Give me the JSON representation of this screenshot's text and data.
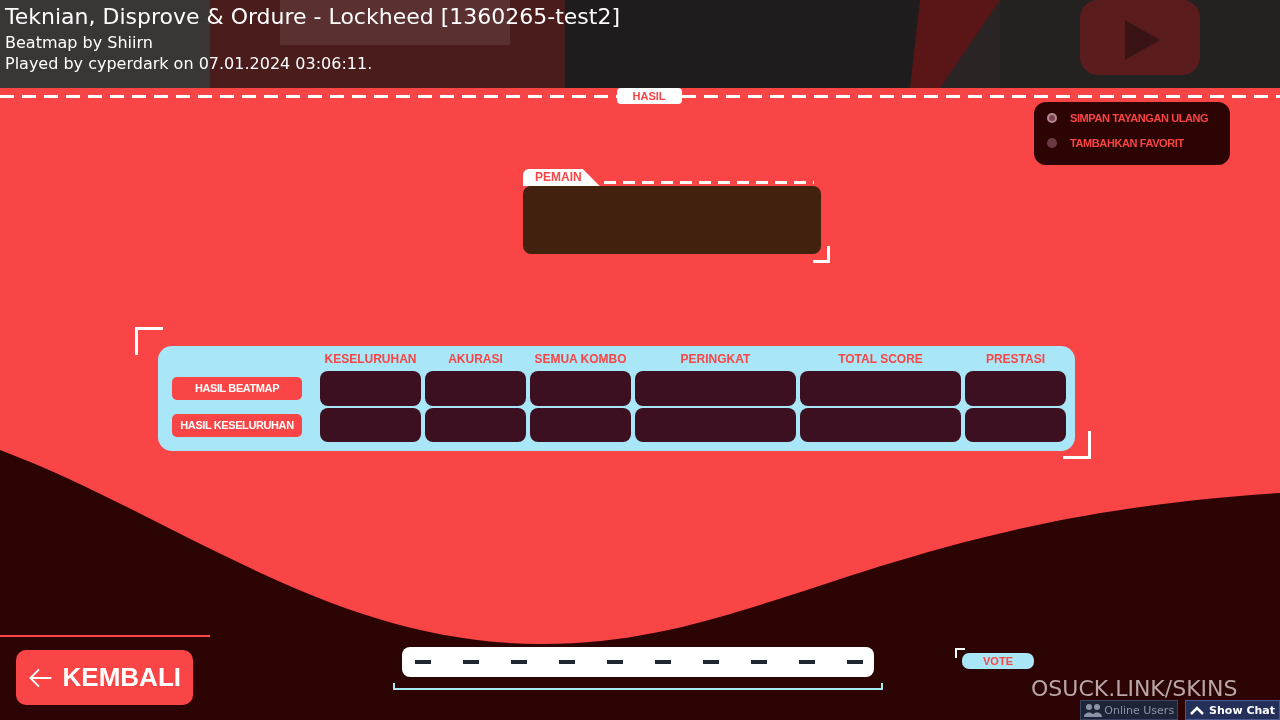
{
  "header": {
    "title": "Teknian, Disprove & Ordure - Lockheed [1360265-test2]",
    "beatmap_by": "Beatmap by Shiirn",
    "played_by": "Played by cyperdark on 07.01.2024 03:06:11."
  },
  "section_tab": "HASIL",
  "options": [
    {
      "label": "SIMPAN TAYANGAN ULANG",
      "kind": "ring"
    },
    {
      "label": "TAMBAHKAN FAVORIT",
      "kind": "dot"
    }
  ],
  "player_panel": {
    "label": "PEMAIN"
  },
  "results_table": {
    "columns": [
      "KESELURUHAN",
      "AKURASI",
      "SEMUA KOMBO",
      "PERINGKAT",
      "TOTAL SCORE",
      "PRESTASI"
    ],
    "rows": [
      {
        "label": "HASIL BEATMAP"
      },
      {
        "label": "HASIL KESELURUHAN"
      }
    ]
  },
  "back_button": {
    "label": "KEMBALI"
  },
  "vote_button": {
    "label": "VOTE"
  },
  "skin_link": "OSUCK.LINK/SKINS",
  "chat_bar": {
    "online_users": "Online Users",
    "show_chat": "Show Chat"
  }
}
